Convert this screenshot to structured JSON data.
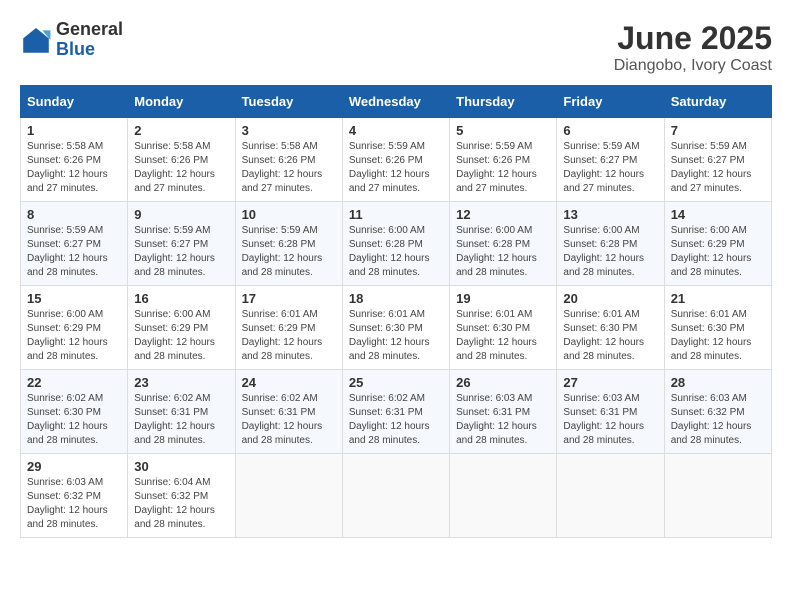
{
  "logo": {
    "general": "General",
    "blue": "Blue"
  },
  "title": "June 2025",
  "subtitle": "Diangobo, Ivory Coast",
  "days_header": [
    "Sunday",
    "Monday",
    "Tuesday",
    "Wednesday",
    "Thursday",
    "Friday",
    "Saturday"
  ],
  "weeks": [
    [
      {
        "day": "1",
        "info": "Sunrise: 5:58 AM\nSunset: 6:26 PM\nDaylight: 12 hours\nand 27 minutes."
      },
      {
        "day": "2",
        "info": "Sunrise: 5:58 AM\nSunset: 6:26 PM\nDaylight: 12 hours\nand 27 minutes."
      },
      {
        "day": "3",
        "info": "Sunrise: 5:58 AM\nSunset: 6:26 PM\nDaylight: 12 hours\nand 27 minutes."
      },
      {
        "day": "4",
        "info": "Sunrise: 5:59 AM\nSunset: 6:26 PM\nDaylight: 12 hours\nand 27 minutes."
      },
      {
        "day": "5",
        "info": "Sunrise: 5:59 AM\nSunset: 6:26 PM\nDaylight: 12 hours\nand 27 minutes."
      },
      {
        "day": "6",
        "info": "Sunrise: 5:59 AM\nSunset: 6:27 PM\nDaylight: 12 hours\nand 27 minutes."
      },
      {
        "day": "7",
        "info": "Sunrise: 5:59 AM\nSunset: 6:27 PM\nDaylight: 12 hours\nand 27 minutes."
      }
    ],
    [
      {
        "day": "8",
        "info": "Sunrise: 5:59 AM\nSunset: 6:27 PM\nDaylight: 12 hours\nand 28 minutes."
      },
      {
        "day": "9",
        "info": "Sunrise: 5:59 AM\nSunset: 6:27 PM\nDaylight: 12 hours\nand 28 minutes."
      },
      {
        "day": "10",
        "info": "Sunrise: 5:59 AM\nSunset: 6:28 PM\nDaylight: 12 hours\nand 28 minutes."
      },
      {
        "day": "11",
        "info": "Sunrise: 6:00 AM\nSunset: 6:28 PM\nDaylight: 12 hours\nand 28 minutes."
      },
      {
        "day": "12",
        "info": "Sunrise: 6:00 AM\nSunset: 6:28 PM\nDaylight: 12 hours\nand 28 minutes."
      },
      {
        "day": "13",
        "info": "Sunrise: 6:00 AM\nSunset: 6:28 PM\nDaylight: 12 hours\nand 28 minutes."
      },
      {
        "day": "14",
        "info": "Sunrise: 6:00 AM\nSunset: 6:29 PM\nDaylight: 12 hours\nand 28 minutes."
      }
    ],
    [
      {
        "day": "15",
        "info": "Sunrise: 6:00 AM\nSunset: 6:29 PM\nDaylight: 12 hours\nand 28 minutes."
      },
      {
        "day": "16",
        "info": "Sunrise: 6:00 AM\nSunset: 6:29 PM\nDaylight: 12 hours\nand 28 minutes."
      },
      {
        "day": "17",
        "info": "Sunrise: 6:01 AM\nSunset: 6:29 PM\nDaylight: 12 hours\nand 28 minutes."
      },
      {
        "day": "18",
        "info": "Sunrise: 6:01 AM\nSunset: 6:30 PM\nDaylight: 12 hours\nand 28 minutes."
      },
      {
        "day": "19",
        "info": "Sunrise: 6:01 AM\nSunset: 6:30 PM\nDaylight: 12 hours\nand 28 minutes."
      },
      {
        "day": "20",
        "info": "Sunrise: 6:01 AM\nSunset: 6:30 PM\nDaylight: 12 hours\nand 28 minutes."
      },
      {
        "day": "21",
        "info": "Sunrise: 6:01 AM\nSunset: 6:30 PM\nDaylight: 12 hours\nand 28 minutes."
      }
    ],
    [
      {
        "day": "22",
        "info": "Sunrise: 6:02 AM\nSunset: 6:30 PM\nDaylight: 12 hours\nand 28 minutes."
      },
      {
        "day": "23",
        "info": "Sunrise: 6:02 AM\nSunset: 6:31 PM\nDaylight: 12 hours\nand 28 minutes."
      },
      {
        "day": "24",
        "info": "Sunrise: 6:02 AM\nSunset: 6:31 PM\nDaylight: 12 hours\nand 28 minutes."
      },
      {
        "day": "25",
        "info": "Sunrise: 6:02 AM\nSunset: 6:31 PM\nDaylight: 12 hours\nand 28 minutes."
      },
      {
        "day": "26",
        "info": "Sunrise: 6:03 AM\nSunset: 6:31 PM\nDaylight: 12 hours\nand 28 minutes."
      },
      {
        "day": "27",
        "info": "Sunrise: 6:03 AM\nSunset: 6:31 PM\nDaylight: 12 hours\nand 28 minutes."
      },
      {
        "day": "28",
        "info": "Sunrise: 6:03 AM\nSunset: 6:32 PM\nDaylight: 12 hours\nand 28 minutes."
      }
    ],
    [
      {
        "day": "29",
        "info": "Sunrise: 6:03 AM\nSunset: 6:32 PM\nDaylight: 12 hours\nand 28 minutes."
      },
      {
        "day": "30",
        "info": "Sunrise: 6:04 AM\nSunset: 6:32 PM\nDaylight: 12 hours\nand 28 minutes."
      },
      {
        "day": "",
        "info": ""
      },
      {
        "day": "",
        "info": ""
      },
      {
        "day": "",
        "info": ""
      },
      {
        "day": "",
        "info": ""
      },
      {
        "day": "",
        "info": ""
      }
    ]
  ]
}
